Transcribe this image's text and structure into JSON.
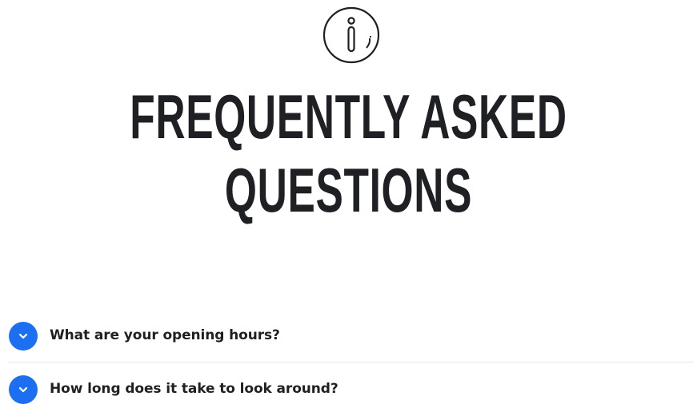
{
  "header": {
    "icon": "info-icon",
    "title_line1": "Frequently Asked",
    "title_line2": "Questions"
  },
  "faq": {
    "items": [
      {
        "question": "What are your opening hours?",
        "icon": "chevron-down-icon"
      },
      {
        "question": "How long does it take to look around?",
        "icon": "chevron-down-icon"
      }
    ]
  },
  "colors": {
    "accent": "#1d6ff2",
    "text": "#1f2024",
    "divider": "#e7e7e9"
  }
}
